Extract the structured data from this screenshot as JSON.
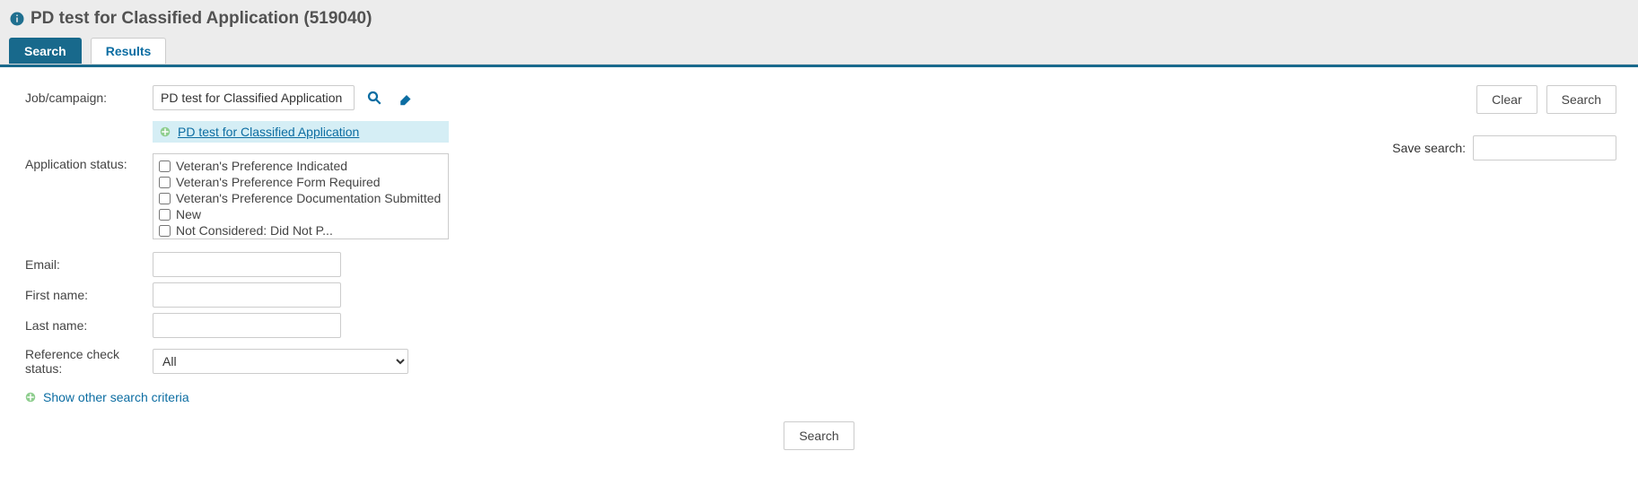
{
  "header": {
    "title": "PD test for Classified Application (519040)"
  },
  "tabs": {
    "search": "Search",
    "results": "Results"
  },
  "labels": {
    "job_campaign": "Job/campaign:",
    "application_status": "Application status:",
    "email": "Email:",
    "first_name": "First name:",
    "last_name": "Last name:",
    "reference_check_status": "Reference check status:",
    "show_other": "Show other search criteria",
    "save_search": "Save search:"
  },
  "values": {
    "job_campaign": "PD test for Classified Application",
    "tag": "PD test for Classified Application",
    "reference_status_selected": "All",
    "email": "",
    "first_name": "",
    "last_name": "",
    "save_search": ""
  },
  "status_options": [
    "Veteran's Preference Indicated",
    "Veteran's Preference Form Required",
    "Veteran's Preference Documentation Submitted",
    "New",
    "Not Considered: Did Not P..."
  ],
  "buttons": {
    "clear": "Clear",
    "search": "Search"
  }
}
